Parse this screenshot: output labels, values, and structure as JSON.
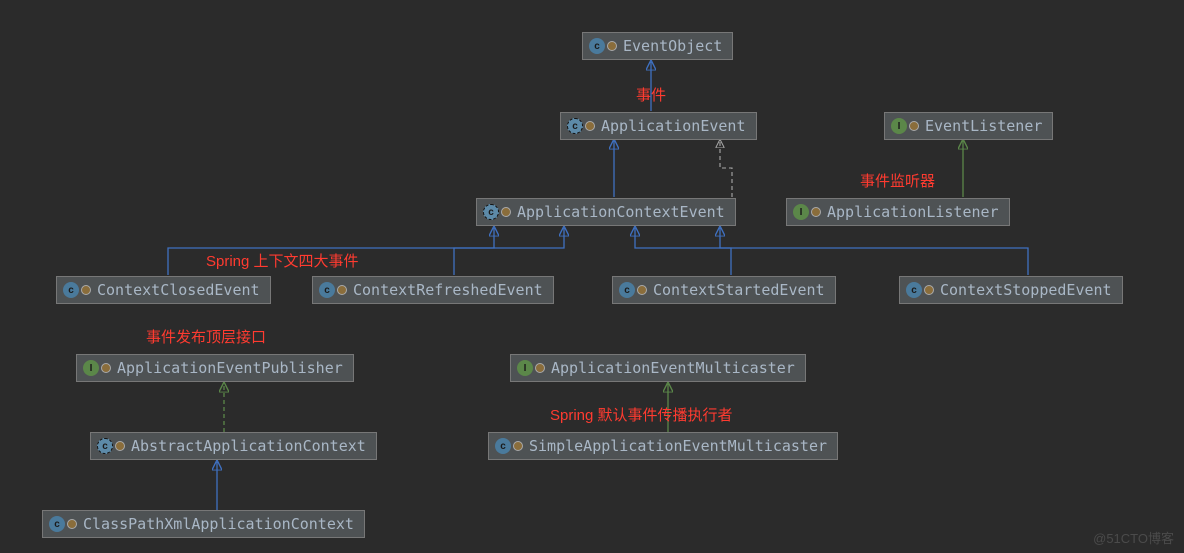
{
  "nodes": {
    "eventObject": {
      "label": "EventObject",
      "kind": "class"
    },
    "applicationEvent": {
      "label": "ApplicationEvent",
      "kind": "abstract"
    },
    "eventListener": {
      "label": "EventListener",
      "kind": "interface"
    },
    "applicationContextEvent": {
      "label": "ApplicationContextEvent",
      "kind": "abstract"
    },
    "applicationListener": {
      "label": "ApplicationListener",
      "kind": "interface"
    },
    "contextClosedEvent": {
      "label": "ContextClosedEvent",
      "kind": "class"
    },
    "contextRefreshedEvent": {
      "label": "ContextRefreshedEvent",
      "kind": "class"
    },
    "contextStartedEvent": {
      "label": "ContextStartedEvent",
      "kind": "class"
    },
    "contextStoppedEvent": {
      "label": "ContextStoppedEvent",
      "kind": "class"
    },
    "applicationEventPublisher": {
      "label": "ApplicationEventPublisher",
      "kind": "interface"
    },
    "applicationEventMulticaster": {
      "label": "ApplicationEventMulticaster",
      "kind": "interface"
    },
    "abstractApplicationContext": {
      "label": "AbstractApplicationContext",
      "kind": "abstract"
    },
    "simpleApplicationEventMulticaster": {
      "label": "SimpleApplicationEventMulticaster",
      "kind": "class"
    },
    "classPathXmlApplicationContext": {
      "label": "ClassPathXmlApplicationContext",
      "kind": "class"
    }
  },
  "annotations": {
    "event": "事件",
    "eventListener": "事件监听器",
    "fourContextEvents": "Spring 上下文四大事件",
    "publisherTopIfc": "事件发布顶层接口",
    "defaultMulticaster": "Spring 默认事件传播执行者"
  },
  "watermark": "@51CTO博客",
  "iconGlyphs": {
    "class": "c",
    "abstract": "c",
    "interface": "I"
  }
}
